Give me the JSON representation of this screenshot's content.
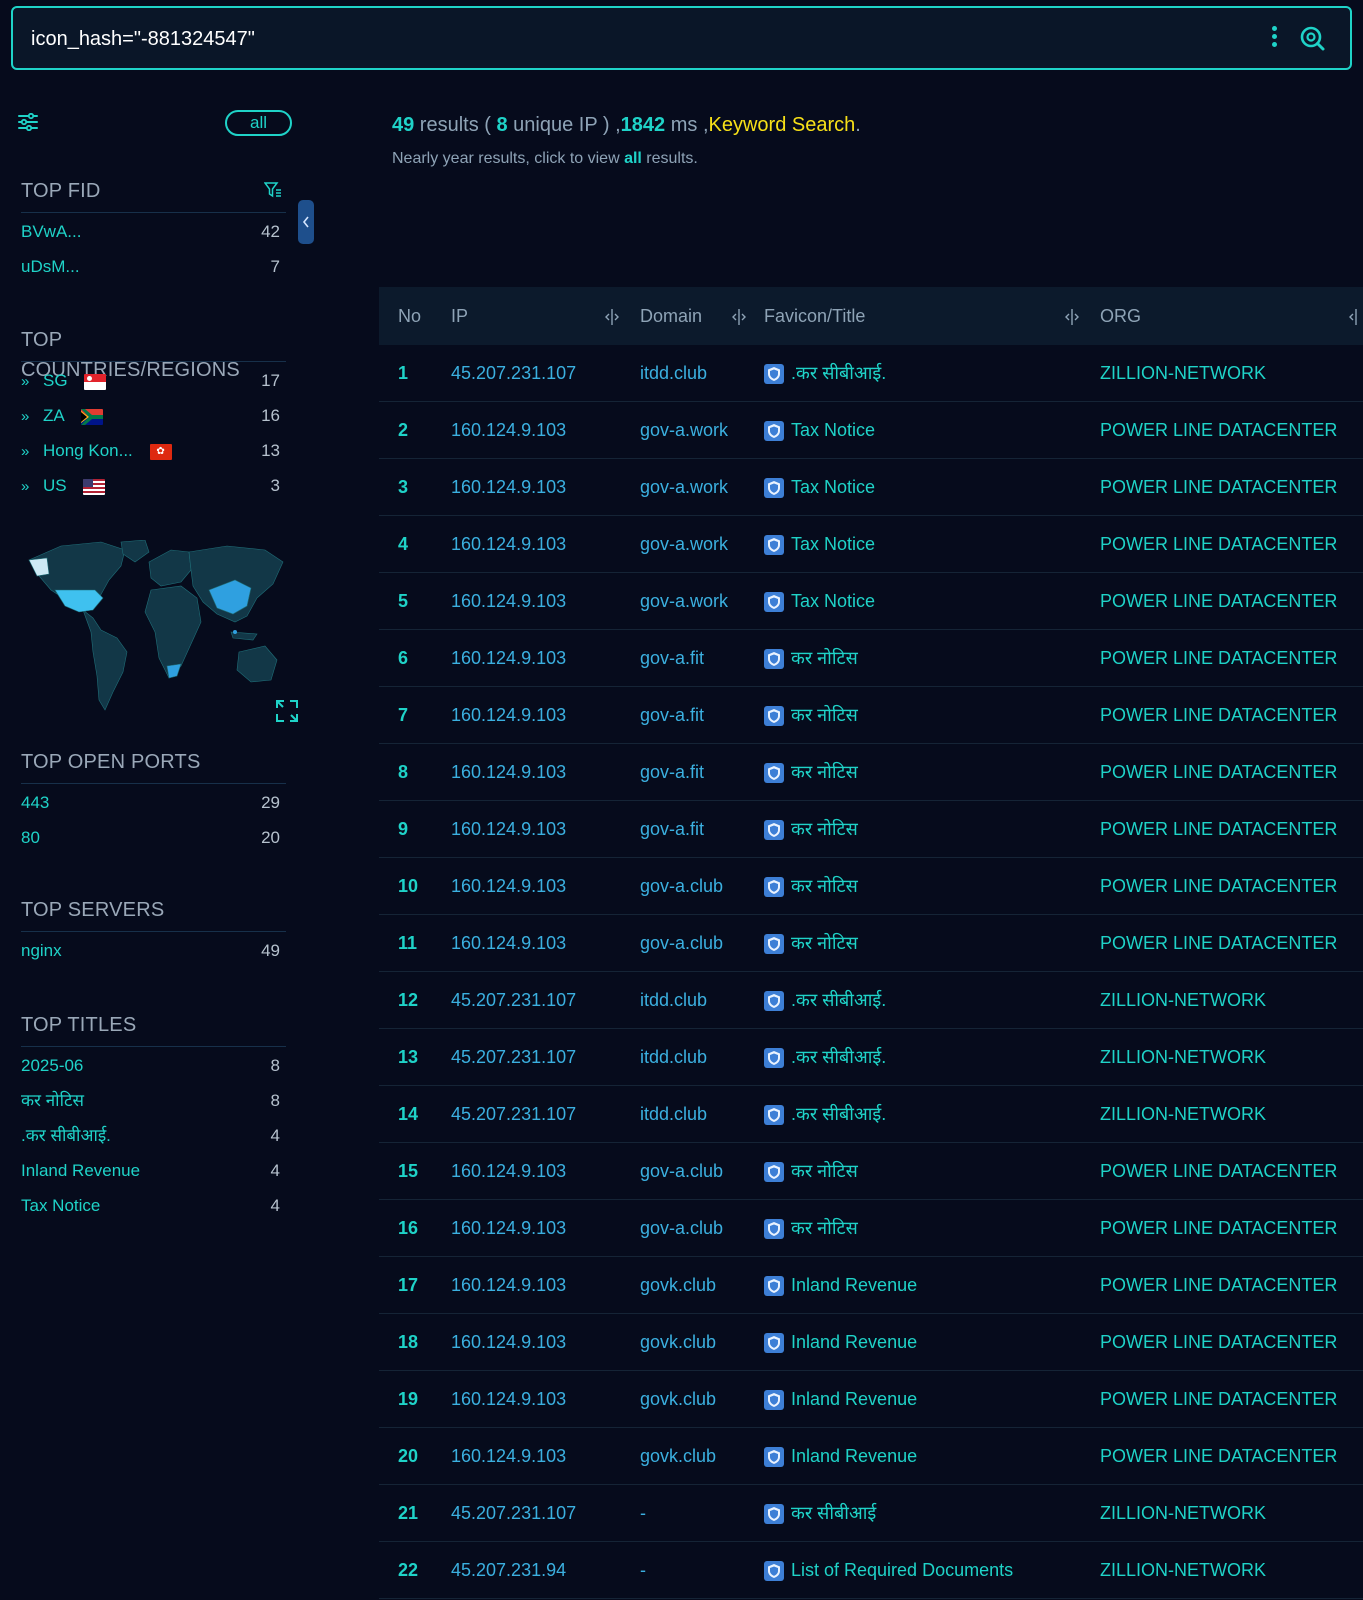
{
  "search": {
    "query": "icon_hash=\"-881324547\""
  },
  "sidebar": {
    "all_label": "all",
    "top_fid": {
      "heading": "TOP FID",
      "items": [
        {
          "label": "BVwA...",
          "count": "42"
        },
        {
          "label": "uDsM...",
          "count": "7"
        }
      ]
    },
    "top_countries": {
      "heading": "TOP COUNTRIES/REGIONS",
      "items": [
        {
          "label": "SG",
          "count": "17",
          "flag": "sg-flag"
        },
        {
          "label": "ZA",
          "count": "16",
          "flag": "za-flag"
        },
        {
          "label": "Hong Kon...",
          "count": "13",
          "flag": "hk-flag"
        },
        {
          "label": "US",
          "count": "3",
          "flag": "us-flag"
        }
      ]
    },
    "top_ports": {
      "heading": "TOP OPEN PORTS",
      "items": [
        {
          "label": "443",
          "count": "29"
        },
        {
          "label": "80",
          "count": "20"
        }
      ]
    },
    "top_servers": {
      "heading": "TOP SERVERS",
      "items": [
        {
          "label": "nginx",
          "count": "49"
        }
      ]
    },
    "top_titles": {
      "heading": "TOP TITLES",
      "items": [
        {
          "label": "2025-06",
          "count": "8"
        },
        {
          "label": "कर नोटिस",
          "count": "8"
        },
        {
          "label": ".कर सीबीआई.",
          "count": "4"
        },
        {
          "label": "Inland Revenue",
          "count": "4"
        },
        {
          "label": "Tax Notice",
          "count": "4"
        }
      ]
    }
  },
  "summary": {
    "results": "49",
    "results_word": " results ( ",
    "unique": "8",
    "unique_word": " unique IP ) ,",
    "ms": "1842",
    "ms_word": " ms ,",
    "keyword": "Keyword Search",
    "dot": ".",
    "sub_pre": "Nearly year results, click to view ",
    "sub_link": "all",
    "sub_post": " results."
  },
  "table": {
    "headers": {
      "no": "No",
      "ip": "IP",
      "domain": "Domain",
      "title": "Favicon/Title",
      "org": "ORG"
    },
    "rows": [
      {
        "no": "1",
        "ip": "45.207.231.107",
        "domain": "itdd.club",
        "title": ".कर सीबीआई.",
        "org": "ZILLION-NETWORK"
      },
      {
        "no": "2",
        "ip": "160.124.9.103",
        "domain": "gov-a.work",
        "title": "Tax Notice",
        "org": "POWER LINE DATACENTER"
      },
      {
        "no": "3",
        "ip": "160.124.9.103",
        "domain": "gov-a.work",
        "title": "Tax Notice",
        "org": "POWER LINE DATACENTER"
      },
      {
        "no": "4",
        "ip": "160.124.9.103",
        "domain": "gov-a.work",
        "title": "Tax Notice",
        "org": "POWER LINE DATACENTER"
      },
      {
        "no": "5",
        "ip": "160.124.9.103",
        "domain": "gov-a.work",
        "title": "Tax Notice",
        "org": "POWER LINE DATACENTER"
      },
      {
        "no": "6",
        "ip": "160.124.9.103",
        "domain": "gov-a.fit",
        "title": "कर नोटिस",
        "org": "POWER LINE DATACENTER"
      },
      {
        "no": "7",
        "ip": "160.124.9.103",
        "domain": "gov-a.fit",
        "title": "कर नोटिस",
        "org": "POWER LINE DATACENTER"
      },
      {
        "no": "8",
        "ip": "160.124.9.103",
        "domain": "gov-a.fit",
        "title": "कर नोटिस",
        "org": "POWER LINE DATACENTER"
      },
      {
        "no": "9",
        "ip": "160.124.9.103",
        "domain": "gov-a.fit",
        "title": "कर नोटिस",
        "org": "POWER LINE DATACENTER"
      },
      {
        "no": "10",
        "ip": "160.124.9.103",
        "domain": "gov-a.club",
        "title": "कर नोटिस",
        "org": "POWER LINE DATACENTER"
      },
      {
        "no": "11",
        "ip": "160.124.9.103",
        "domain": "gov-a.club",
        "title": "कर नोटिस",
        "org": "POWER LINE DATACENTER"
      },
      {
        "no": "12",
        "ip": "45.207.231.107",
        "domain": "itdd.club",
        "title": ".कर सीबीआई.",
        "org": "ZILLION-NETWORK"
      },
      {
        "no": "13",
        "ip": "45.207.231.107",
        "domain": "itdd.club",
        "title": ".कर सीबीआई.",
        "org": "ZILLION-NETWORK"
      },
      {
        "no": "14",
        "ip": "45.207.231.107",
        "domain": "itdd.club",
        "title": ".कर सीबीआई.",
        "org": "ZILLION-NETWORK"
      },
      {
        "no": "15",
        "ip": "160.124.9.103",
        "domain": "gov-a.club",
        "title": "कर नोटिस",
        "org": "POWER LINE DATACENTER"
      },
      {
        "no": "16",
        "ip": "160.124.9.103",
        "domain": "gov-a.club",
        "title": "कर नोटिस",
        "org": "POWER LINE DATACENTER"
      },
      {
        "no": "17",
        "ip": "160.124.9.103",
        "domain": "govk.club",
        "title": "Inland Revenue",
        "org": "POWER LINE DATACENTER"
      },
      {
        "no": "18",
        "ip": "160.124.9.103",
        "domain": "govk.club",
        "title": "Inland Revenue",
        "org": "POWER LINE DATACENTER"
      },
      {
        "no": "19",
        "ip": "160.124.9.103",
        "domain": "govk.club",
        "title": "Inland Revenue",
        "org": "POWER LINE DATACENTER"
      },
      {
        "no": "20",
        "ip": "160.124.9.103",
        "domain": "govk.club",
        "title": "Inland Revenue",
        "org": "POWER LINE DATACENTER"
      },
      {
        "no": "21",
        "ip": "45.207.231.107",
        "domain": "-",
        "title": "कर सीबीआई",
        "org": "ZILLION-NETWORK"
      },
      {
        "no": "22",
        "ip": "45.207.231.94",
        "domain": "-",
        "title": "List of Required Documents",
        "org": "ZILLION-NETWORK"
      }
    ]
  },
  "colors": {
    "accent": "#1fd3c8",
    "link": "#3bb0e0",
    "keyword": "#f7e018",
    "background": "#060b1c"
  },
  "icons": [
    "more-vertical-icon",
    "search-icon",
    "filter-sliders-icon",
    "funnel-icon",
    "chevron-left-icon",
    "double-chevron-icon",
    "world-map",
    "expand-icon",
    "shield-favicon-icon",
    "column-resize-icon"
  ]
}
